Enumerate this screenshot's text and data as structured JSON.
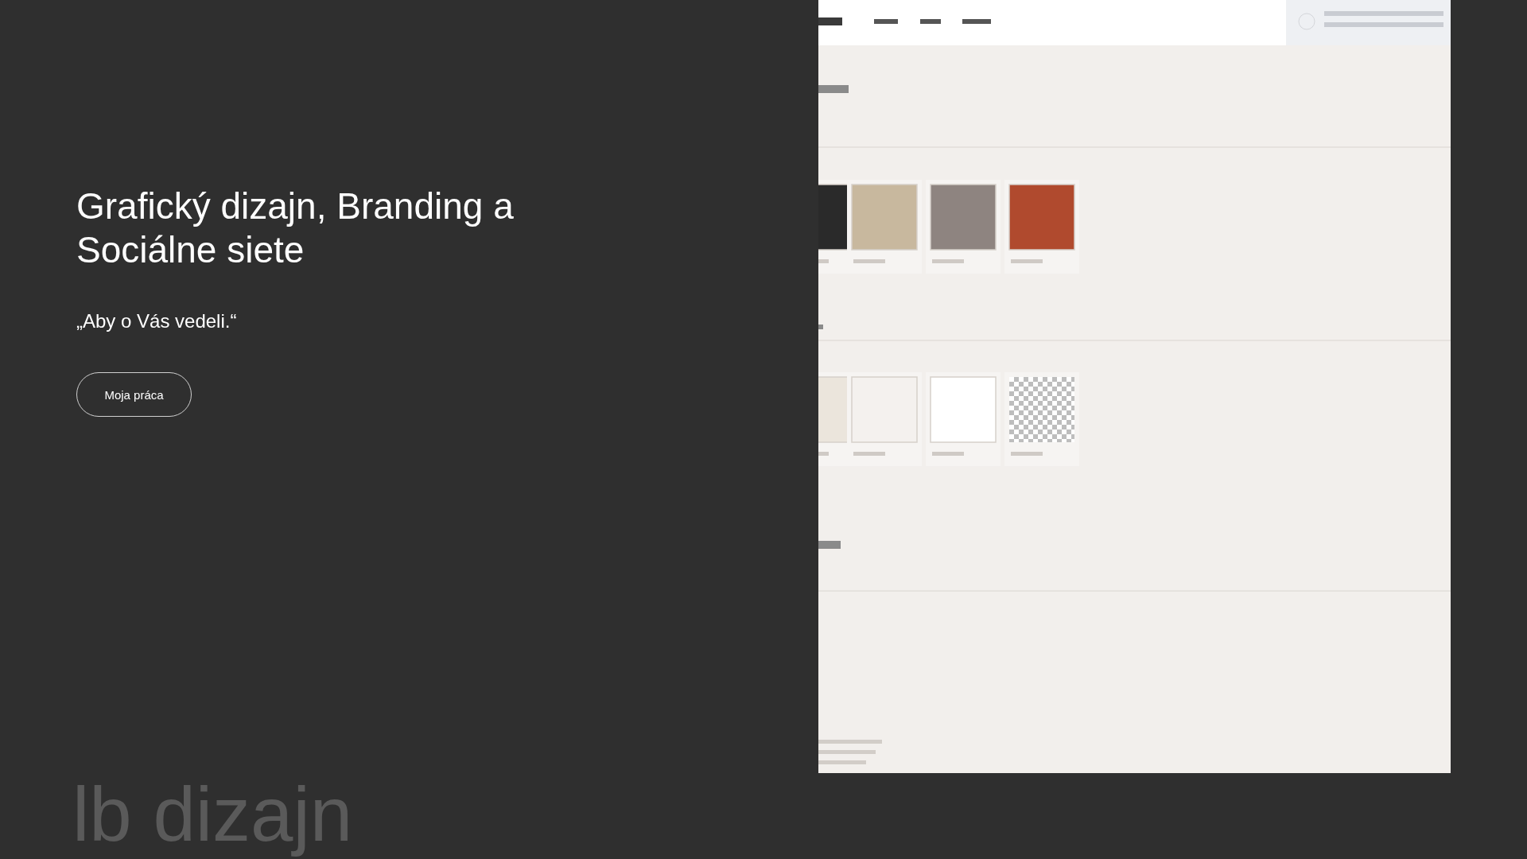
{
  "hero": {
    "title": "Grafický dizajn, Branding a Sociálne siete",
    "quote": "„Aby o Vás vedeli.“",
    "button": "Moja práca"
  },
  "preview": {
    "swatches_top": [
      {
        "color": "#2a2a2a"
      },
      {
        "color": "#c8b89e"
      },
      {
        "color": "#8e8480"
      },
      {
        "color": "#b04a2e"
      }
    ],
    "swatches_bottom": [
      {
        "color": "#ebe5dc"
      },
      {
        "color": "#f4f1ee"
      },
      {
        "color": "#ffffff"
      },
      {
        "color": "#ffffff",
        "kind": "checker"
      }
    ]
  },
  "marquee": "lb dizajn"
}
